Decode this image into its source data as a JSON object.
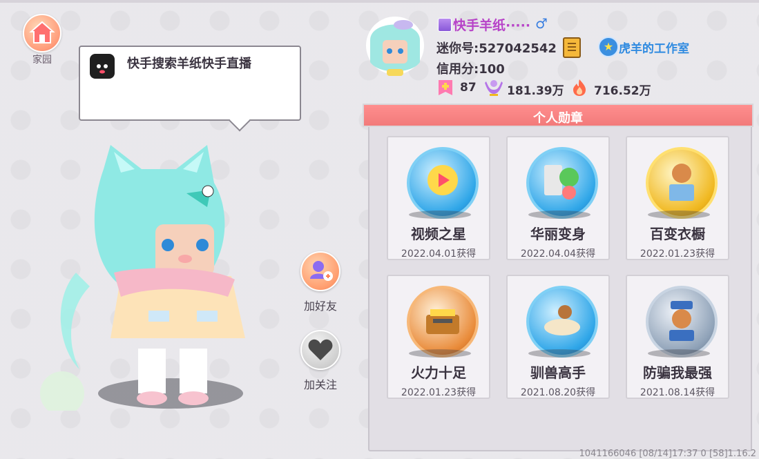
{
  "home": {
    "label": "家园",
    "icon": "home-icon"
  },
  "bubble": {
    "text": "快手搜索羊纸快手直播",
    "icon": "black-cat-icon"
  },
  "actions": {
    "add_friend": "加好友",
    "follow": "加关注"
  },
  "profile": {
    "nickname": "快手羊纸·····",
    "mini_id": "迷你号:527042542",
    "studio": "虎羊的工作室",
    "credit": "信用分:100",
    "stats": [
      {
        "icon": "plus-level-icon",
        "value": "87"
      },
      {
        "icon": "trophy-person-icon",
        "value": "181.39万"
      },
      {
        "icon": "flame-icon",
        "value": "716.52万"
      }
    ]
  },
  "badges_panel": {
    "title": "个人勋章",
    "badges": [
      {
        "name": "视频之星",
        "date": "2022.04.01获得",
        "color": "#2fa6e8",
        "icon": "video-star-medal-icon"
      },
      {
        "name": "华丽变身",
        "date": "2022.04.04获得",
        "color": "#2fa6e8",
        "icon": "transform-medal-icon"
      },
      {
        "name": "百变衣橱",
        "date": "2022.01.23获得",
        "color": "#f0b820",
        "icon": "wardrobe-medal-icon"
      },
      {
        "name": "火力十足",
        "date": "2022.01.23获得",
        "color": "#e98b3a",
        "icon": "firepower-medal-icon"
      },
      {
        "name": "驯兽高手",
        "date": "2021.08.20获得",
        "color": "#2fa6e8",
        "icon": "tamer-medal-icon"
      },
      {
        "name": "防骗我最强",
        "date": "2021.08.14获得",
        "color": "#8fa2b8",
        "icon": "anti-fraud-medal-icon"
      }
    ]
  },
  "footer": "1041166046   [08/14]17:37 0  [58]1.16.2",
  "colors": {
    "header": "#f27a7a",
    "nickname": "#b742c8",
    "studio": "#2f8ae0"
  }
}
